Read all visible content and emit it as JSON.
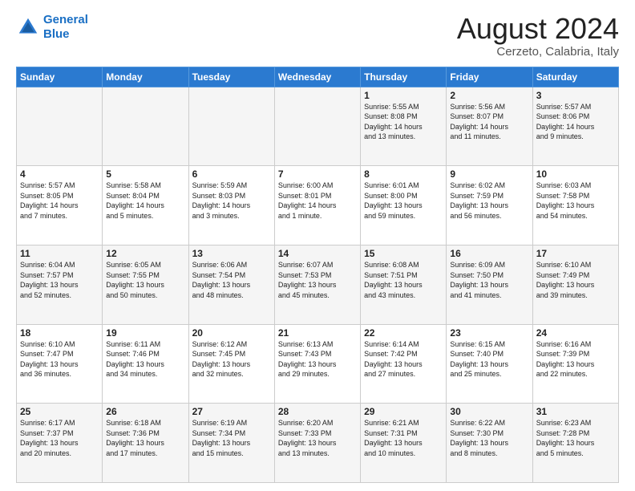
{
  "logo": {
    "line1": "General",
    "line2": "Blue"
  },
  "title": "August 2024",
  "subtitle": "Cerzeto, Calabria, Italy",
  "days_of_week": [
    "Sunday",
    "Monday",
    "Tuesday",
    "Wednesday",
    "Thursday",
    "Friday",
    "Saturday"
  ],
  "weeks": [
    [
      {
        "day": "",
        "text": ""
      },
      {
        "day": "",
        "text": ""
      },
      {
        "day": "",
        "text": ""
      },
      {
        "day": "",
        "text": ""
      },
      {
        "day": "1",
        "text": "Sunrise: 5:55 AM\nSunset: 8:08 PM\nDaylight: 14 hours\nand 13 minutes."
      },
      {
        "day": "2",
        "text": "Sunrise: 5:56 AM\nSunset: 8:07 PM\nDaylight: 14 hours\nand 11 minutes."
      },
      {
        "day": "3",
        "text": "Sunrise: 5:57 AM\nSunset: 8:06 PM\nDaylight: 14 hours\nand 9 minutes."
      }
    ],
    [
      {
        "day": "4",
        "text": "Sunrise: 5:57 AM\nSunset: 8:05 PM\nDaylight: 14 hours\nand 7 minutes."
      },
      {
        "day": "5",
        "text": "Sunrise: 5:58 AM\nSunset: 8:04 PM\nDaylight: 14 hours\nand 5 minutes."
      },
      {
        "day": "6",
        "text": "Sunrise: 5:59 AM\nSunset: 8:03 PM\nDaylight: 14 hours\nand 3 minutes."
      },
      {
        "day": "7",
        "text": "Sunrise: 6:00 AM\nSunset: 8:01 PM\nDaylight: 14 hours\nand 1 minute."
      },
      {
        "day": "8",
        "text": "Sunrise: 6:01 AM\nSunset: 8:00 PM\nDaylight: 13 hours\nand 59 minutes."
      },
      {
        "day": "9",
        "text": "Sunrise: 6:02 AM\nSunset: 7:59 PM\nDaylight: 13 hours\nand 56 minutes."
      },
      {
        "day": "10",
        "text": "Sunrise: 6:03 AM\nSunset: 7:58 PM\nDaylight: 13 hours\nand 54 minutes."
      }
    ],
    [
      {
        "day": "11",
        "text": "Sunrise: 6:04 AM\nSunset: 7:57 PM\nDaylight: 13 hours\nand 52 minutes."
      },
      {
        "day": "12",
        "text": "Sunrise: 6:05 AM\nSunset: 7:55 PM\nDaylight: 13 hours\nand 50 minutes."
      },
      {
        "day": "13",
        "text": "Sunrise: 6:06 AM\nSunset: 7:54 PM\nDaylight: 13 hours\nand 48 minutes."
      },
      {
        "day": "14",
        "text": "Sunrise: 6:07 AM\nSunset: 7:53 PM\nDaylight: 13 hours\nand 45 minutes."
      },
      {
        "day": "15",
        "text": "Sunrise: 6:08 AM\nSunset: 7:51 PM\nDaylight: 13 hours\nand 43 minutes."
      },
      {
        "day": "16",
        "text": "Sunrise: 6:09 AM\nSunset: 7:50 PM\nDaylight: 13 hours\nand 41 minutes."
      },
      {
        "day": "17",
        "text": "Sunrise: 6:10 AM\nSunset: 7:49 PM\nDaylight: 13 hours\nand 39 minutes."
      }
    ],
    [
      {
        "day": "18",
        "text": "Sunrise: 6:10 AM\nSunset: 7:47 PM\nDaylight: 13 hours\nand 36 minutes."
      },
      {
        "day": "19",
        "text": "Sunrise: 6:11 AM\nSunset: 7:46 PM\nDaylight: 13 hours\nand 34 minutes."
      },
      {
        "day": "20",
        "text": "Sunrise: 6:12 AM\nSunset: 7:45 PM\nDaylight: 13 hours\nand 32 minutes."
      },
      {
        "day": "21",
        "text": "Sunrise: 6:13 AM\nSunset: 7:43 PM\nDaylight: 13 hours\nand 29 minutes."
      },
      {
        "day": "22",
        "text": "Sunrise: 6:14 AM\nSunset: 7:42 PM\nDaylight: 13 hours\nand 27 minutes."
      },
      {
        "day": "23",
        "text": "Sunrise: 6:15 AM\nSunset: 7:40 PM\nDaylight: 13 hours\nand 25 minutes."
      },
      {
        "day": "24",
        "text": "Sunrise: 6:16 AM\nSunset: 7:39 PM\nDaylight: 13 hours\nand 22 minutes."
      }
    ],
    [
      {
        "day": "25",
        "text": "Sunrise: 6:17 AM\nSunset: 7:37 PM\nDaylight: 13 hours\nand 20 minutes."
      },
      {
        "day": "26",
        "text": "Sunrise: 6:18 AM\nSunset: 7:36 PM\nDaylight: 13 hours\nand 17 minutes."
      },
      {
        "day": "27",
        "text": "Sunrise: 6:19 AM\nSunset: 7:34 PM\nDaylight: 13 hours\nand 15 minutes."
      },
      {
        "day": "28",
        "text": "Sunrise: 6:20 AM\nSunset: 7:33 PM\nDaylight: 13 hours\nand 13 minutes."
      },
      {
        "day": "29",
        "text": "Sunrise: 6:21 AM\nSunset: 7:31 PM\nDaylight: 13 hours\nand 10 minutes."
      },
      {
        "day": "30",
        "text": "Sunrise: 6:22 AM\nSunset: 7:30 PM\nDaylight: 13 hours\nand 8 minutes."
      },
      {
        "day": "31",
        "text": "Sunrise: 6:23 AM\nSunset: 7:28 PM\nDaylight: 13 hours\nand 5 minutes."
      }
    ]
  ]
}
